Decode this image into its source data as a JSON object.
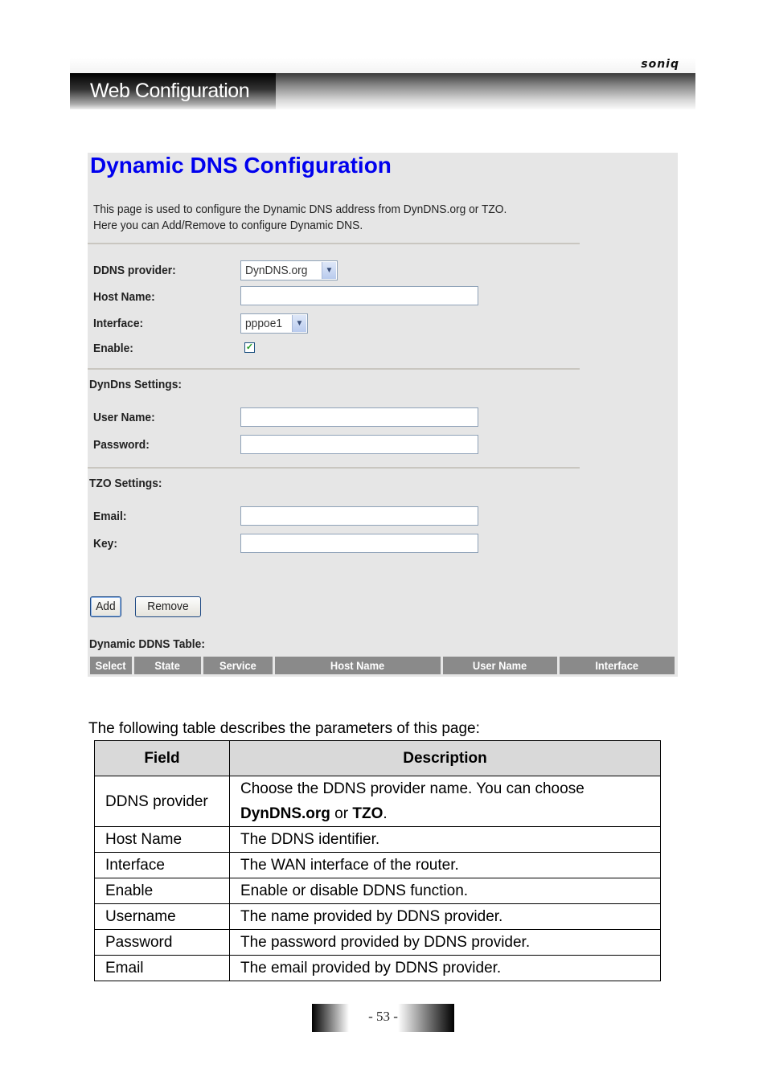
{
  "header": {
    "brand": "soniq",
    "section_tab": "Web Configuration"
  },
  "screen": {
    "title": "Dynamic DNS Configuration",
    "description_line1": "This page is used to configure the Dynamic DNS address from DynDNS.org or TZO.",
    "description_line2": "Here you can Add/Remove to configure Dynamic DNS.",
    "fields": {
      "ddns_provider": {
        "label": "DDNS provider:",
        "value": "DynDNS.org"
      },
      "host_name": {
        "label": "Host Name:",
        "value": ""
      },
      "interface": {
        "label": "Interface:",
        "value": "pppoe1"
      },
      "enable": {
        "label": "Enable:",
        "checked": true
      }
    },
    "dyndns_section": {
      "title": "DynDns Settings:",
      "user_name": {
        "label": "User Name:",
        "value": ""
      },
      "password": {
        "label": "Password:",
        "value": ""
      }
    },
    "tzo_section": {
      "title": "TZO Settings:",
      "email": {
        "label": "Email:",
        "value": ""
      },
      "key": {
        "label": "Key:",
        "value": ""
      }
    },
    "buttons": {
      "add": "Add",
      "remove": "Remove"
    },
    "ddns_table": {
      "title": "Dynamic DDNS Table:",
      "columns": [
        "Select",
        "State",
        "Service",
        "Host Name",
        "User Name",
        "Interface"
      ]
    }
  },
  "doc": {
    "intro": "The following table describes the parameters of this page:",
    "table": {
      "headers": [
        "Field",
        "Description"
      ],
      "rows": [
        {
          "field": "DDNS provider",
          "desc_pre": "Choose the DDNS provider name. You can choose ",
          "bold1": "DynDNS.org",
          "mid": " or ",
          "bold2": "TZO",
          "post": "."
        },
        {
          "field": "Host Name",
          "desc": "The DDNS identifier."
        },
        {
          "field": "Interface",
          "desc": "The WAN interface of the router."
        },
        {
          "field": "Enable",
          "desc": "Enable or disable DDNS function."
        },
        {
          "field": "Username",
          "desc": "The name provided by DDNS provider."
        },
        {
          "field": "Password",
          "desc": "The password provided by DDNS provider."
        },
        {
          "field": "Email",
          "desc": "The email provided by DDNS provider."
        }
      ]
    },
    "page_number": "- 53 -"
  }
}
